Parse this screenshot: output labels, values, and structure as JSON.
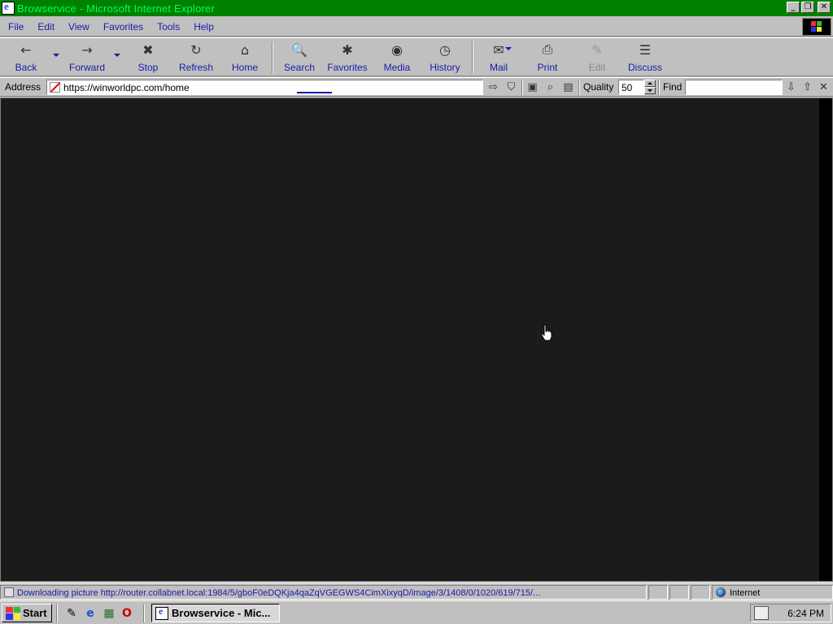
{
  "window": {
    "title": "Browservice - Microsoft Internet Explorer",
    "btn_minimize": "_",
    "btn_restore": "❐",
    "btn_close": "✕"
  },
  "menu": [
    {
      "label": "File"
    },
    {
      "label": "Edit"
    },
    {
      "label": "View"
    },
    {
      "label": "Favorites"
    },
    {
      "label": "Tools"
    },
    {
      "label": "Help"
    }
  ],
  "toolbar": {
    "back": {
      "label": "Back",
      "icon": "←"
    },
    "forward": {
      "label": "Forward",
      "icon": "→"
    },
    "stop": {
      "label": "Stop",
      "icon": "✖"
    },
    "refresh": {
      "label": "Refresh",
      "icon": "↻"
    },
    "home": {
      "label": "Home",
      "icon": "⌂"
    },
    "search": {
      "label": "Search",
      "icon": "🔍"
    },
    "favorites": {
      "label": "Favorites",
      "icon": "✱"
    },
    "media": {
      "label": "Media",
      "icon": "◉"
    },
    "history": {
      "label": "History",
      "icon": "◷"
    },
    "mail": {
      "label": "Mail",
      "icon": "✉"
    },
    "print": {
      "label": "Print",
      "icon": "⎙"
    },
    "edit": {
      "label": "Edit",
      "icon": "✎"
    },
    "discuss": {
      "label": "Discuss",
      "icon": "☰"
    }
  },
  "address": {
    "label": "Address",
    "url": "https://winworldpc.com/home"
  },
  "addr_icons": {
    "go": "⇨",
    "bookmark": "⛉",
    "save": "▣",
    "find": "⌕",
    "clipboard": "▤",
    "find_next": "⇩",
    "find_prev": "⇧",
    "find_close": "✕"
  },
  "quality": {
    "label": "Quality",
    "value": "50"
  },
  "find": {
    "label": "Find",
    "value": ""
  },
  "status": {
    "message": "Downloading picture http://router.collabnet.local:1984/5/gboF0eDQKja4qaZqVGEGWS4CimXixyqD/image/3/1408/0/1020/619/715/...",
    "zone": "Internet"
  },
  "taskbar": {
    "start_label": "Start",
    "quicklaunch": [
      {
        "name": "ql-edit-icon",
        "glyph": "✎",
        "color": "#333333"
      },
      {
        "name": "ql-ie-icon",
        "glyph": "e",
        "color": "#1b4fd6"
      },
      {
        "name": "ql-desktop-icon",
        "glyph": "▦",
        "color": "#2a6a2a"
      },
      {
        "name": "ql-opera-icon",
        "glyph": "O",
        "color": "#d00000"
      }
    ],
    "task_label": "Browservice - Mic...",
    "clock": "6:24 PM"
  },
  "colors": {
    "titlebar_bg": "#008000",
    "titlebar_text": "#00ff5a",
    "menu_text": "#1a1aa8",
    "content_bg": "#1b1b1b",
    "chrome": "#c0c0c0"
  }
}
